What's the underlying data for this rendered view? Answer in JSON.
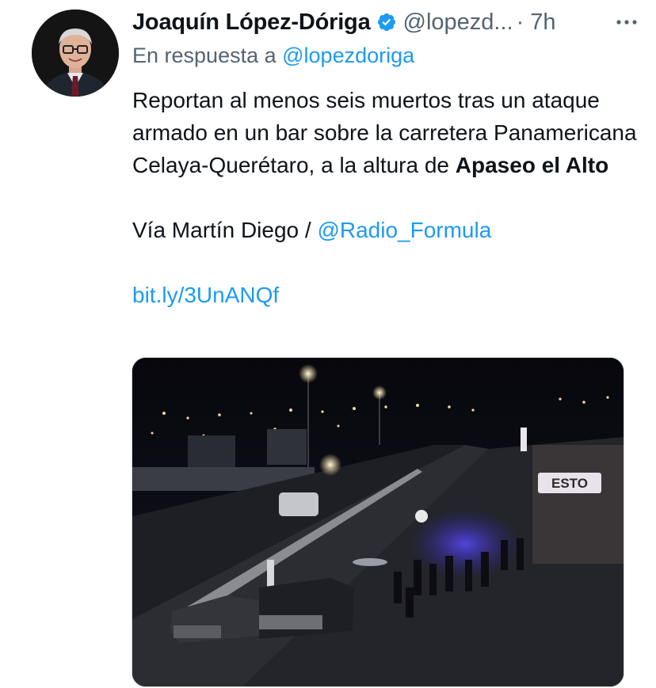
{
  "author": {
    "name": "Joaquín López-Dóriga",
    "handle": "@lopezd...",
    "time": "· 7h"
  },
  "reply_to": {
    "prefix": "En respuesta a ",
    "handle": "@lopezdoriga"
  },
  "tweet": {
    "line1": "Reportan al menos seis muertos tras un ataque armado en un bar sobre la carretera Panamericana Celaya-Querétaro, a la altura de ",
    "bold_place": "Apaseo el Alto",
    "via_prefix": "Vía Martín Diego / ",
    "via_handle": "@Radio_Formula",
    "short_link": "bit.ly/3UnANQf"
  },
  "media": {
    "sign_text": "ESTO"
  },
  "icons": {
    "verified": "verified-badge-icon",
    "more": "more-options-icon"
  },
  "colors": {
    "link": "#1d9bf0",
    "secondary_text": "#536471",
    "primary_text": "#0f1419"
  }
}
